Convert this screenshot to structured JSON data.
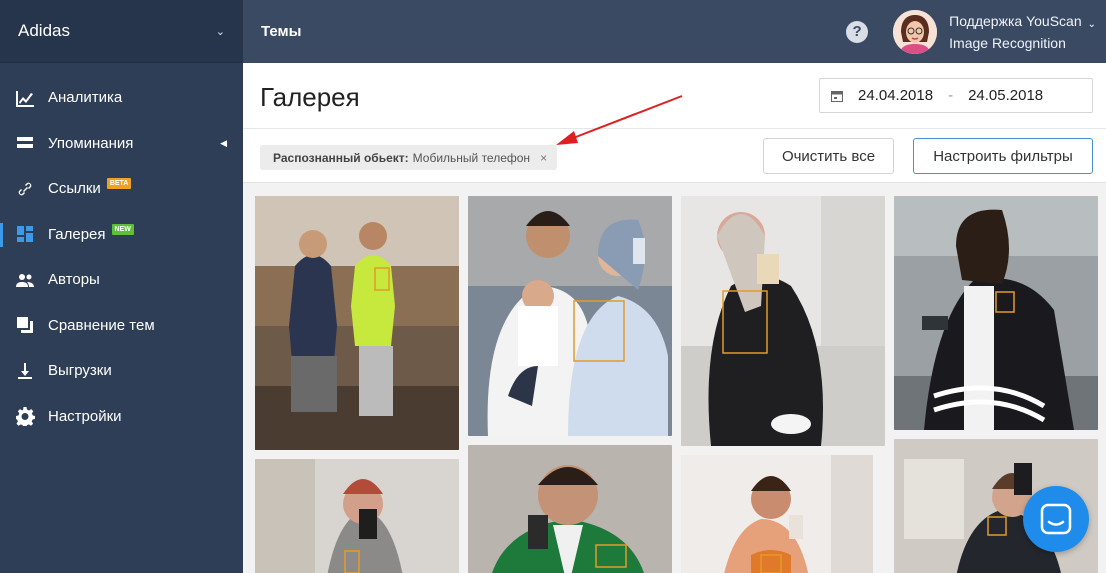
{
  "sidebar": {
    "project_name": "Adidas",
    "items": [
      {
        "label": "Аналитика",
        "icon": "chart-icon"
      },
      {
        "label": "Упоминания",
        "icon": "mentions-icon"
      },
      {
        "label": "Ссылки",
        "icon": "link-icon",
        "badge": "BETA"
      },
      {
        "label": "Галерея",
        "icon": "gallery-icon",
        "badge": "NEW",
        "active": true
      },
      {
        "label": "Авторы",
        "icon": "authors-icon"
      },
      {
        "label": "Сравнение тем",
        "icon": "compare-icon"
      },
      {
        "label": "Выгрузки",
        "icon": "download-icon"
      },
      {
        "label": "Настройки",
        "icon": "gear-icon"
      }
    ]
  },
  "topbar": {
    "section": "Темы",
    "help": "?",
    "user_line1": "Поддержка YouScan",
    "user_line2": "Image Recognition"
  },
  "header": {
    "title": "Галерея",
    "date_from": "24.04.2018",
    "date_sep": "-",
    "date_to": "24.05.2018"
  },
  "filters": {
    "chip_key": "Распознанный обьект:",
    "chip_value": "Мобильный телефон",
    "chip_close": "×",
    "clear_label": "Очистить все",
    "config_label": "Настроить фильтры"
  },
  "colors": {
    "sidebar": "#2e3e56",
    "topbar": "#3a4a63",
    "accent": "#3c9ae8",
    "annotation_arrow": "#e02020",
    "chat": "#1f8ceb"
  }
}
